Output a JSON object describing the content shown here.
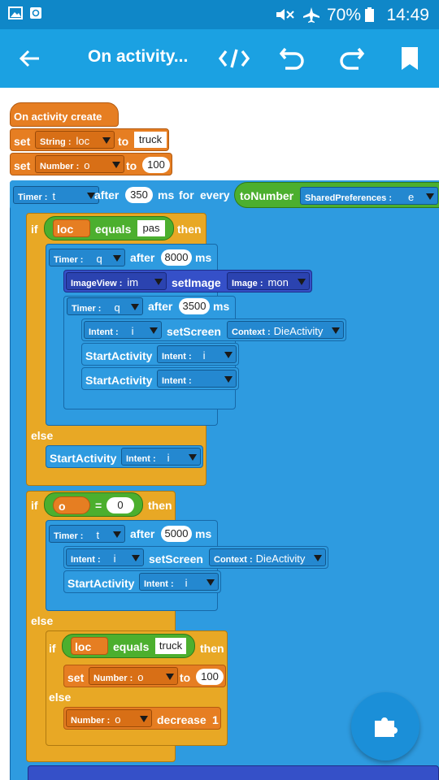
{
  "status_bar": {
    "battery": "70%",
    "time": "14:49"
  },
  "app_bar": {
    "title": "On activity..."
  },
  "colors": {
    "status_bar": "#0f87c8",
    "app_bar": "#1ba1e2",
    "event_block": "#e67e22",
    "control_block": "#e8a825",
    "timer_block": "#2e9be0",
    "component_block": "#3550c8",
    "logic_block": "#4caf2e"
  },
  "icons": [
    "image-icon",
    "recycle-icon",
    "mute-icon",
    "airplane-icon",
    "battery-icon",
    "back-arrow-icon",
    "code-icon",
    "undo-icon",
    "redo-icon",
    "bookmark-icon",
    "puzzle-icon"
  ],
  "blocks": {
    "event": "On activity create",
    "set1": {
      "kw": "set",
      "type": "String :",
      "var": "loc",
      "to": "to",
      "value": "truck"
    },
    "set2": {
      "kw": "set",
      "type": "Number :",
      "var": "o",
      "to": "to",
      "value": "100"
    },
    "timer_t": {
      "type": "Timer :",
      "var": "t",
      "after": "after",
      "ms_value": "350",
      "ms": "ms",
      "for": "for",
      "every": "every",
      "to_number": "toNumber",
      "prefs_type": "SharedPreferences :",
      "prefs_var": "e"
    },
    "if1": {
      "kw": "if",
      "var": "loc",
      "op": "equals",
      "value": "pas",
      "then": "then"
    },
    "timer_q1": {
      "type": "Timer :",
      "var": "q",
      "after": "after",
      "value": "8000",
      "ms": "ms"
    },
    "image_view": {
      "type": "ImageView :",
      "var": "im",
      "method": "setImage",
      "arg_type": "Image :",
      "arg_var": "mon"
    },
    "timer_q2": {
      "type": "Timer :",
      "var": "q",
      "after": "after",
      "value": "3500",
      "ms": "ms"
    },
    "intent1": {
      "type": "Intent :",
      "var": "i",
      "method": "setScreen",
      "ctx_type": "Context :",
      "ctx_var": "DieActivity"
    },
    "start1": {
      "label": "StartActivity",
      "type": "Intent :",
      "var": "i"
    },
    "start2": {
      "label": "StartActivity",
      "type": "Intent :",
      "var": ""
    },
    "else1": "else",
    "start3": {
      "label": "StartActivity",
      "type": "Intent :",
      "var": "i"
    },
    "if2": {
      "kw": "if",
      "op": "=",
      "value": "0",
      "then": "then"
    },
    "timer_t2": {
      "type": "Timer :",
      "var": "t",
      "after": "after",
      "value": "5000",
      "ms": "ms"
    },
    "intent2": {
      "type": "Intent :",
      "var": "i",
      "method": "setScreen",
      "ctx_type": "Context :",
      "ctx_var": "DieActivity"
    },
    "start4": {
      "label": "StartActivity",
      "type": "Intent :",
      "var": "i"
    },
    "else2": "else",
    "if3": {
      "kw": "if",
      "var": "loc",
      "op": "equals",
      "value": "truck",
      "then": "then"
    },
    "set3": {
      "kw": "set",
      "type": "Number :",
      "var": "o",
      "to": "to",
      "value": "100"
    },
    "else3": "else",
    "decrement": {
      "type": "Number :",
      "var": "o",
      "method": "decrease",
      "value": "1"
    }
  }
}
